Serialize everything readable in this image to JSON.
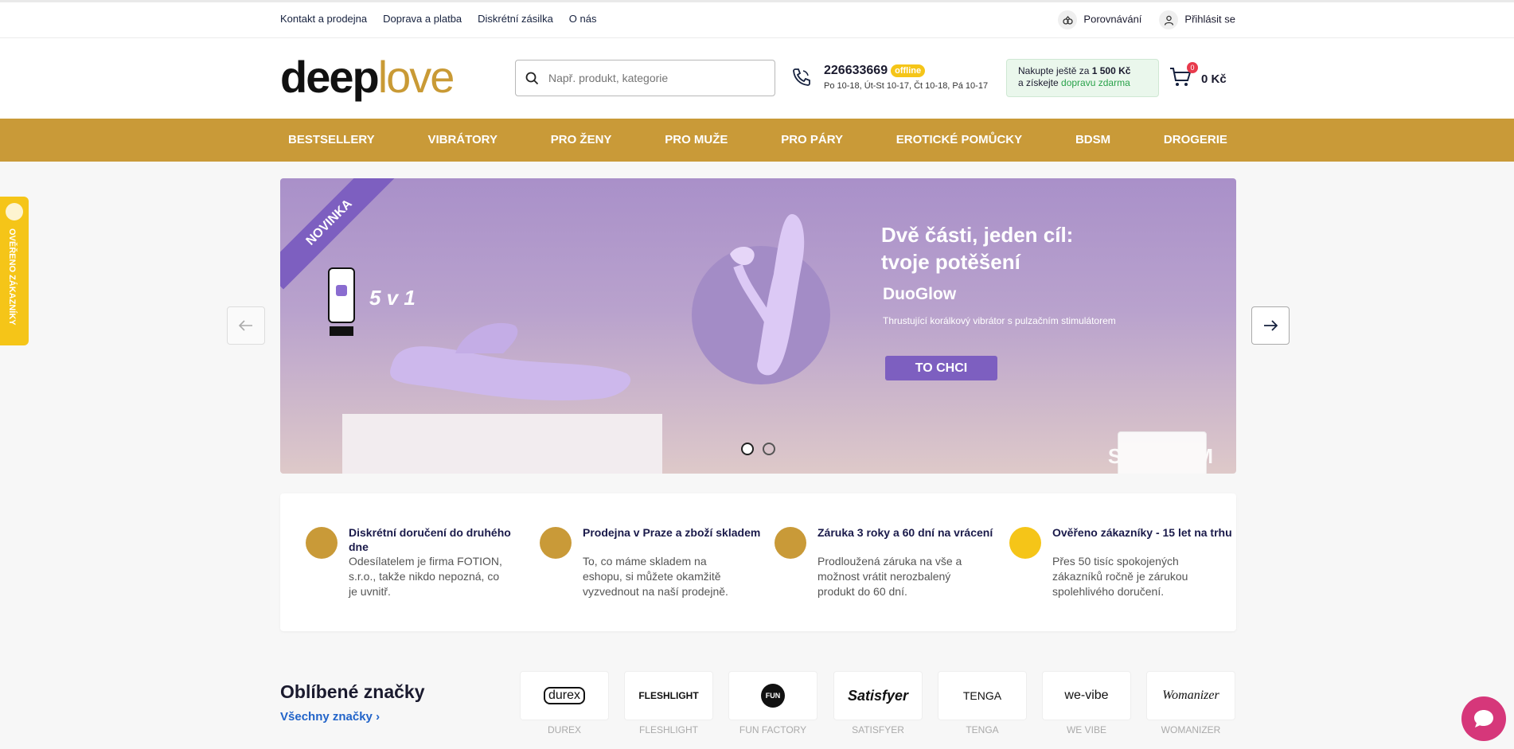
{
  "topbar": {
    "links": [
      "Kontakt a prodejna",
      "Doprava a platba",
      "Diskrétní zásilka",
      "O nás"
    ],
    "compare": "Porovnávání",
    "login": "Přihlásit se"
  },
  "header": {
    "logo_dark": "deep",
    "logo_light": "love",
    "search_placeholder": "Např. produkt, kategorie",
    "phone": "226633669",
    "phone_status": "offline",
    "hours": "Po 10-18, Út-St 10-17, Čt 10-18, Pá 10-17",
    "freeship_line1_prefix": "Nakupte ještě za ",
    "freeship_amount": "1 500 Kč",
    "freeship_line2_prefix": "a získejte ",
    "freeship_link": "dopravu zdarma",
    "cart_count": "0",
    "cart_price": "0 Kč"
  },
  "nav": [
    "BESTSELLERY",
    "VIBRÁTORY",
    "PRO ŽENY",
    "PRO MUŽE",
    "PRO PÁRY",
    "EROTICKÉ POMŮCKY",
    "BDSM",
    "DROGERIE"
  ],
  "side_tab": "OVĚŘENO ZÁKAZNÍKY",
  "banner": {
    "ribbon": "NOVINKA",
    "headline_1": "Dvě části, jeden cíl:",
    "headline_2": "tvoje potěšení",
    "product": "DuoGlow",
    "description": "Thrustující korálkový vibrátor s pulzačním stimulátorem",
    "cta": "TO CHCI",
    "five_in_one": "5 v 1",
    "brand": "SVAKOM",
    "slides": 2,
    "active_slide": 1
  },
  "benefits": [
    {
      "title": "Diskrétní doručení do druhého dne",
      "text": "Odesílatelem je firma FOTION, s.r.o., takže nikdo nepozná, co je uvnitř.",
      "icon": "truck-icon"
    },
    {
      "title": "Prodejna v Praze a zboží skladem",
      "text": "To, co máme skladem na eshopu, si můžete okamžitě vyzvednout na naší prodejně.",
      "icon": "shop-icon"
    },
    {
      "title": "Záruka 3 roky a 60 dní na vrácení",
      "text": "Prodloužená záruka na vše a možnost vrátit nerozbalený produkt do 60 dní.",
      "icon": "clipboard-icon"
    },
    {
      "title": "Ověřeno zákazníky - 15 let na trhu",
      "text": "Přes 50 tisíc spokojených zákazníků ročně je zárukou spolehlivého doručení.",
      "icon": "badge-icon"
    }
  ],
  "brands": {
    "title": "Oblíbené značky",
    "all_link": "Všechny značky ›",
    "items": [
      {
        "logo": "durex",
        "name": "DUREX"
      },
      {
        "logo": "FLESHLIGHT",
        "name": "FLESHLIGHT"
      },
      {
        "logo": "FUN",
        "name": "FUN FACTORY"
      },
      {
        "logo": "Satisfyer",
        "name": "SATISFYER"
      },
      {
        "logo": "TENGA",
        "name": "TENGA"
      },
      {
        "logo": "we-vibe",
        "name": "WE VIBE"
      },
      {
        "logo": "Womanizer",
        "name": "WOMANIZER"
      }
    ]
  },
  "colors": {
    "gold": "#c99a38",
    "purple": "#7d5fc0",
    "green": "#29a24a",
    "chat": "#d6377a"
  }
}
